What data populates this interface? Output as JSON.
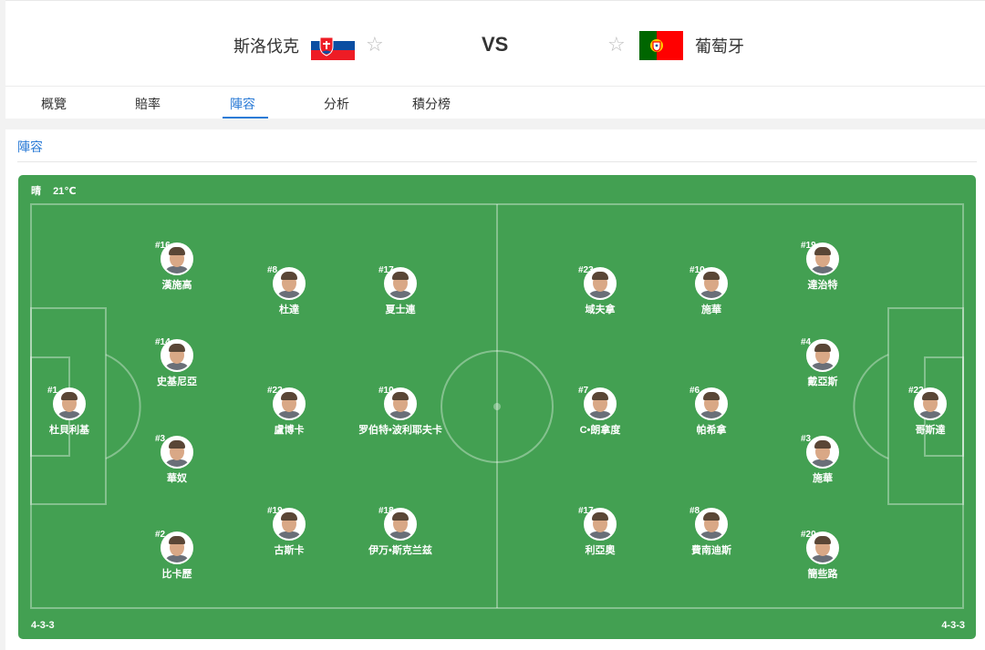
{
  "match": {
    "home_name": "斯洛伐克",
    "away_name": "葡萄牙",
    "vs_label": "VS",
    "home_colors": [
      "#ffffff",
      "#0b4ea2",
      "#ee1c25"
    ],
    "away_colors": [
      "#006600",
      "#ff0000"
    ]
  },
  "tabs": [
    {
      "label": "概覽"
    },
    {
      "label": "賠率"
    },
    {
      "label": "陣容",
      "active": true
    },
    {
      "label": "分析"
    },
    {
      "label": "積分榜"
    }
  ],
  "section": {
    "title": "陣容"
  },
  "pitch": {
    "weather": "晴",
    "temperature": "21℃",
    "home_formation": "4-3-3",
    "away_formation": "4-3-3",
    "pitch_color": "#43a052"
  },
  "home_players": [
    {
      "num": "#1",
      "name": "杜貝利基"
    },
    {
      "num": "#16",
      "name": "漢施高"
    },
    {
      "num": "#14",
      "name": "史基尼亞"
    },
    {
      "num": "#3",
      "name": "華奴"
    },
    {
      "num": "#2",
      "name": "比卡歷"
    },
    {
      "num": "#8",
      "name": "杜達"
    },
    {
      "num": "#22",
      "name": "盧博卡"
    },
    {
      "num": "#19",
      "name": "古斯卡"
    },
    {
      "num": "#17",
      "name": "夏士連"
    },
    {
      "num": "#10",
      "name": "罗伯特•波利耶夫卡"
    },
    {
      "num": "#18",
      "name": "伊万•斯克兰兹"
    }
  ],
  "away_players": [
    {
      "num": "#23",
      "name": "域夫拿"
    },
    {
      "num": "#7",
      "name": "C•朗拿度"
    },
    {
      "num": "#17",
      "name": "利亞奧"
    },
    {
      "num": "#10",
      "name": "施華"
    },
    {
      "num": "#6",
      "name": "帕希拿"
    },
    {
      "num": "#8",
      "name": "費南迪斯"
    },
    {
      "num": "#19",
      "name": "達治特"
    },
    {
      "num": "#4",
      "name": "戴亞斯"
    },
    {
      "num": "#3",
      "name": "施華"
    },
    {
      "num": "#20",
      "name": "簡些路"
    },
    {
      "num": "#22",
      "name": "哥斯達"
    }
  ]
}
